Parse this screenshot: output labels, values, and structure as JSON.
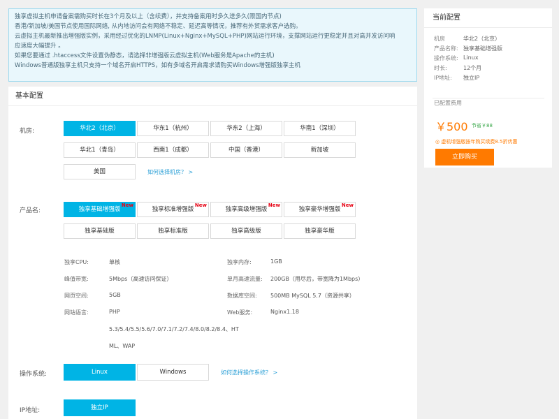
{
  "notice": {
    "lines": [
      "独享虚拟主机申请备案需购买时长在3个月及以上（含续费），并支持备案用时多久送多久(限国内节点)",
      "香港/新加坡/美国节点使用国际网络, 从内地访问会有网络不稳定、延迟高等情况，推荐有外贸需求客户选购。",
      "云虚拟主机最新推出增强版实例，采用经过优化的LNMP(Linux+Nginx+MySQL+PHP)网站运行环境，支撑网站运行更稳定并且对高并发访问响",
      "应速度大幅提升 。",
      "如果您要通过 .htaccess文件设置伪静态，请选择非增强版云虚拟主机(Web服务是Apache的主机)",
      "Windows普通版独享主机只支持一个域名开启HTTPS，如有多域名开启需求请购买Windows增强版独享主机"
    ]
  },
  "main": {
    "title": "基本配置",
    "room": {
      "label": "机房:",
      "options": [
        "华北2（北京）",
        "华东1（杭州）",
        "华东2（上海）",
        "华南1（深圳）",
        "华北1（青岛）",
        "西南1（成都）",
        "中国（香港）",
        "新加坡",
        "美国"
      ],
      "link": "如何选择机房？ >"
    },
    "product": {
      "label": "产品名:",
      "options": [
        "独享基础增强版",
        "独享标准增强版",
        "独享高级增强版",
        "独享豪华增强版",
        "独享基础版",
        "独享标准版",
        "独享高级版",
        "独享豪华版"
      ],
      "new_badge": "New"
    },
    "specs": {
      "cpu_label": "独享CPU:",
      "cpu": "单核",
      "mem_label": "独享内存:",
      "mem": "1GB",
      "bw_label": "峰值带宽:",
      "bw": "5Mbps（高速访问保证）",
      "traffic_label": "单月高速流量:",
      "traffic": "200GB（用尽后，带宽降为1Mbps）",
      "space_label": "网页空间:",
      "space": "5GB",
      "db_label": "数据库空间:",
      "db": "500MB MySQL 5.7（资源共享）",
      "lang_label": "网站语言:",
      "lang": "PHP",
      "web_label": "Web服务:",
      "web": "Nginx1.18",
      "php_versions_1": "5.3/5.4/5.5/5.6/7.0/7.1/7.2/7.4/8.0/8.2/8.4、HT",
      "php_versions_2": "ML、WAP"
    },
    "os": {
      "label": "操作系统:",
      "options": [
        "Linux",
        "Windows"
      ],
      "link": "如何选择操作系统？ >"
    },
    "ip": {
      "label": "IP地址:",
      "option": "独立IP"
    }
  },
  "side": {
    "title": "当前配置",
    "room_label": "机房",
    "room": "华北2（北京）",
    "product_label": "产品名称:",
    "product": "独享基础增强版",
    "os_label": "操作系统:",
    "os": "Linux",
    "duration_label": "时长:",
    "duration": "12个月",
    "ip_label": "IP地址:",
    "ip": "独立IP",
    "fee_label": "已配置费用",
    "price": "￥500",
    "save": "节省￥88",
    "promo": "◎ 虚机增强版按年购买续费8.5折优惠",
    "buy": "立即购买"
  }
}
